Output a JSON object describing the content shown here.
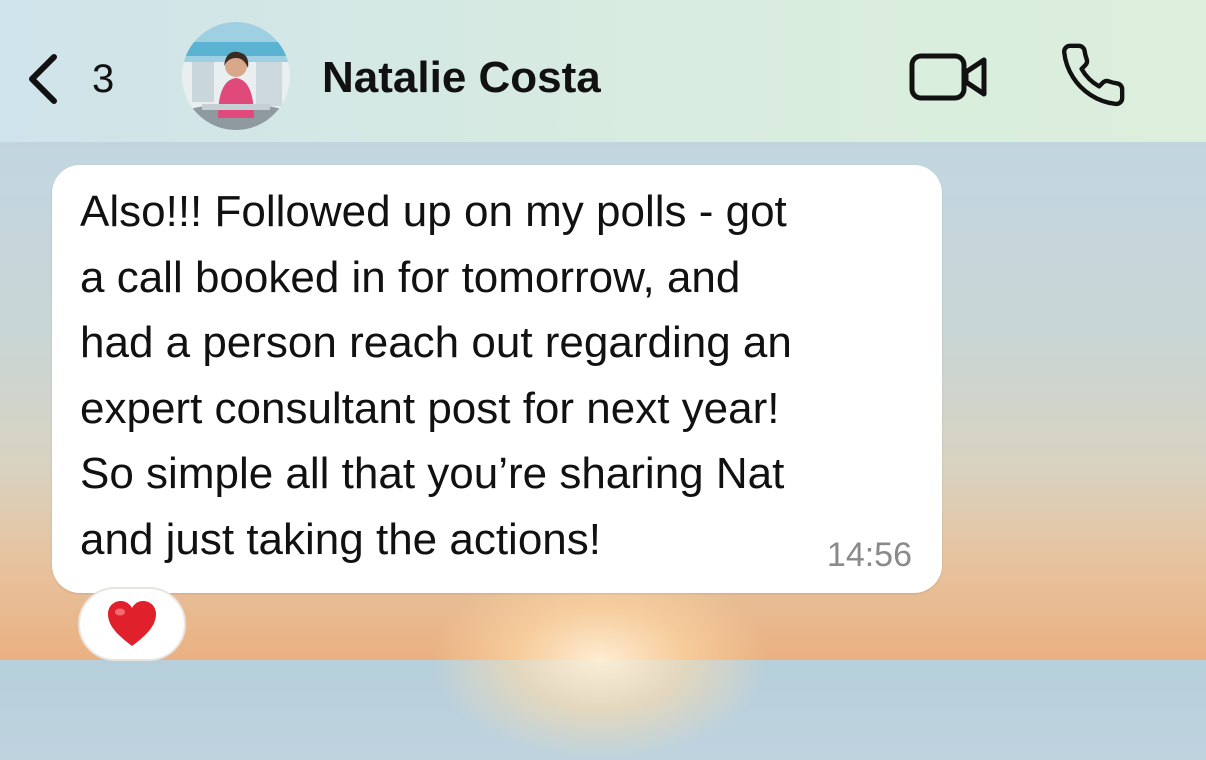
{
  "header": {
    "back_count": "3",
    "contact_name": "Natalie Costa",
    "background_colors": [
      "#cfe3ea",
      "#dcefdc"
    ]
  },
  "icons": {
    "back": "chevron-left-icon",
    "video": "video-camera-icon",
    "phone": "phone-icon",
    "reaction": "red-heart-icon"
  },
  "message": {
    "direction": "incoming",
    "lines": [
      "Also!!! Followed up on my polls - got",
      "a call booked in for tomorrow, and",
      "had a person reach out regarding an",
      "expert consultant post for next year!",
      "So simple all that you’re sharing Nat",
      "and just taking the actions!"
    ],
    "time": "14:56",
    "reaction": "❤️"
  },
  "colors": {
    "bubble": "#ffffff",
    "timestamp": "#8a8a8a",
    "heart": "#e0202b"
  }
}
